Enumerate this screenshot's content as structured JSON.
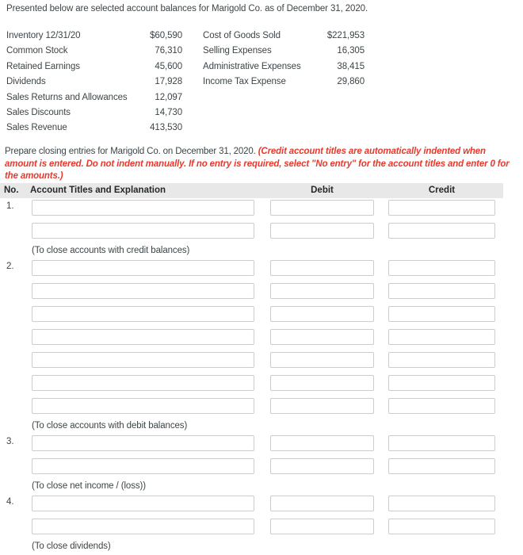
{
  "intro": "Presented below are selected account balances for Marigold Co. as of December 31, 2020.",
  "balances": {
    "left": [
      {
        "label": "Inventory 12/31/20",
        "amount": "$60,590"
      },
      {
        "label": "Common Stock",
        "amount": "76,310"
      },
      {
        "label": "Retained Earnings",
        "amount": "45,600"
      },
      {
        "label": "Dividends",
        "amount": "17,928"
      },
      {
        "label": "Sales Returns and Allowances",
        "amount": "12,097"
      },
      {
        "label": "Sales Discounts",
        "amount": "14,730"
      },
      {
        "label": "Sales Revenue",
        "amount": "413,530"
      }
    ],
    "right": [
      {
        "label": "Cost of Goods Sold",
        "amount": "$221,953"
      },
      {
        "label": "Selling Expenses",
        "amount": "16,305"
      },
      {
        "label": "Administrative Expenses",
        "amount": "38,415"
      },
      {
        "label": "Income Tax Expense",
        "amount": "29,860"
      }
    ]
  },
  "instructions": {
    "lead": "Prepare closing entries for Marigold Co. on December 31, 2020. ",
    "note": "(Credit account titles are automatically indented when amount is entered. Do not indent manually. If no entry is required, select \"No entry\" for the account titles and enter 0 for the amounts.)",
    "note_color": "#e8392c"
  },
  "table": {
    "headers": {
      "no": "No.",
      "titles": "Account Titles and Explanation",
      "debit": "Debit",
      "credit": "Credit"
    },
    "header_bg": "#e8e8e8",
    "field_border": "#cccccc",
    "entries": [
      {
        "no": "1.",
        "rows": 2,
        "caption": "(To close accounts with credit balances)",
        "row_values": [
          {
            "account": "",
            "debit": "",
            "credit": ""
          },
          {
            "account": "",
            "debit": "",
            "credit": ""
          }
        ]
      },
      {
        "no": "2.",
        "rows": 7,
        "caption": "(To close accounts with debit balances)",
        "row_values": [
          {
            "account": "",
            "debit": "",
            "credit": ""
          },
          {
            "account": "",
            "debit": "",
            "credit": ""
          },
          {
            "account": "",
            "debit": "",
            "credit": ""
          },
          {
            "account": "",
            "debit": "",
            "credit": ""
          },
          {
            "account": "",
            "debit": "",
            "credit": ""
          },
          {
            "account": "",
            "debit": "",
            "credit": ""
          },
          {
            "account": "",
            "debit": "",
            "credit": ""
          }
        ]
      },
      {
        "no": "3.",
        "rows": 2,
        "caption": "(To close net income / (loss))",
        "row_values": [
          {
            "account": "",
            "debit": "",
            "credit": ""
          },
          {
            "account": "",
            "debit": "",
            "credit": ""
          }
        ]
      },
      {
        "no": "4.",
        "rows": 2,
        "caption": "(To close dividends)",
        "row_values": [
          {
            "account": "",
            "debit": "",
            "credit": ""
          },
          {
            "account": "",
            "debit": "",
            "credit": ""
          }
        ]
      }
    ]
  }
}
